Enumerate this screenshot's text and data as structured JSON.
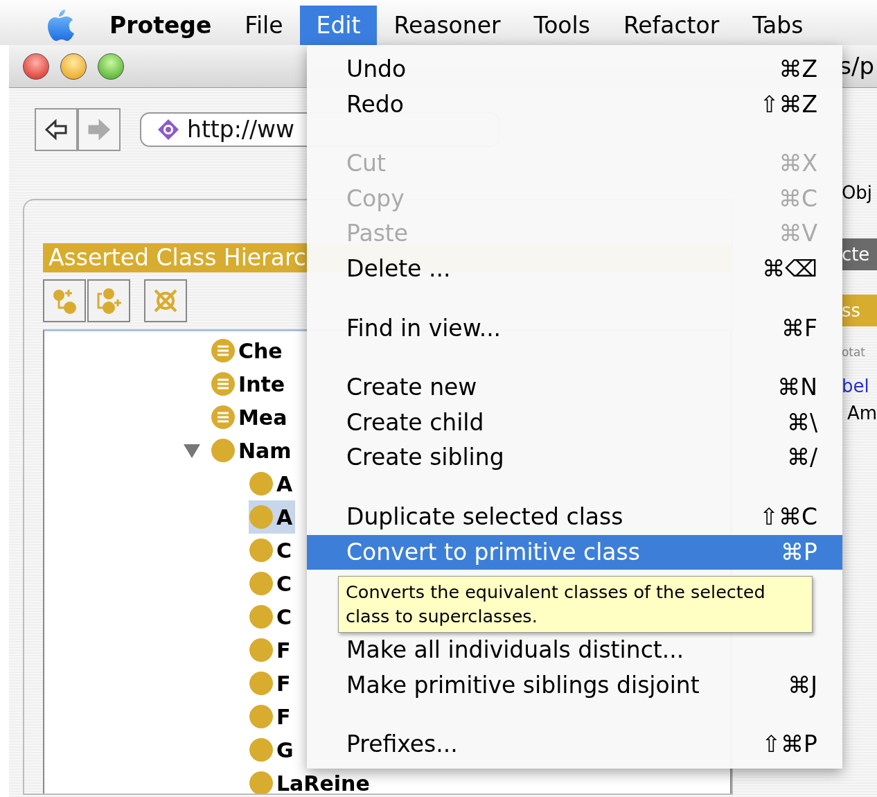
{
  "menu_bar": {
    "items": [
      {
        "label": "Protege",
        "kind": "app",
        "selected": false
      },
      {
        "label": "File",
        "kind": "menu",
        "selected": false
      },
      {
        "label": "Edit",
        "kind": "menu",
        "selected": true
      },
      {
        "label": "Reasoner",
        "kind": "menu",
        "selected": false
      },
      {
        "label": "Tools",
        "kind": "menu",
        "selected": false
      },
      {
        "label": "Refactor",
        "kind": "menu",
        "selected": false
      },
      {
        "label": "Tabs",
        "kind": "menu",
        "selected": false
      }
    ]
  },
  "window": {
    "title": "s/p"
  },
  "toolbar": {
    "nav_buttons": [
      {
        "kind": "back",
        "disabled": false
      },
      {
        "kind": "forward",
        "disabled": true
      }
    ],
    "address": {
      "value": "http://ww"
    }
  },
  "tabs": [
    {
      "label": "Obj"
    }
  ],
  "class_hierarchy": {
    "title": "Asserted Class Hierarc",
    "tools": [
      {
        "kind": "add-subclass"
      },
      {
        "kind": "add-sibling"
      },
      {
        "kind": "delete"
      }
    ],
    "tree": [
      {
        "label": "Che",
        "kind": "defined",
        "selected": false
      },
      {
        "label": "Inte",
        "kind": "defined",
        "selected": false
      },
      {
        "label": "Mea",
        "kind": "defined",
        "selected": false
      },
      {
        "label": "Nam",
        "kind": "primitive",
        "selected": false,
        "expanded": true,
        "children": [
          {
            "label": "A",
            "kind": "primitive",
            "selected": false
          },
          {
            "label": "A",
            "kind": "primitive",
            "selected": true
          },
          {
            "label": "C",
            "kind": "primitive",
            "selected": false
          },
          {
            "label": "C",
            "kind": "primitive",
            "selected": false
          },
          {
            "label": "C",
            "kind": "primitive",
            "selected": false
          },
          {
            "label": "F",
            "kind": "primitive",
            "selected": false
          },
          {
            "label": "F",
            "kind": "primitive",
            "selected": false
          },
          {
            "label": "F",
            "kind": "primitive",
            "selected": false
          },
          {
            "label": "G",
            "kind": "primitive",
            "selected": false
          },
          {
            "label": "LaReine",
            "kind": "primitive",
            "selected": false
          }
        ]
      }
    ]
  },
  "right_panel": {
    "selected_header": "cte",
    "class_header": "ss",
    "annotations_label": "otat",
    "annotation_property": "bel",
    "annotation_value": "Am"
  },
  "edit_menu": {
    "items": [
      {
        "kind": "item",
        "label": "Undo",
        "shortcut": "⌘Z",
        "disabled": false,
        "selected": false
      },
      {
        "kind": "item",
        "label": "Redo",
        "shortcut": "⇧⌘Z",
        "disabled": false,
        "selected": false
      },
      {
        "kind": "separator"
      },
      {
        "kind": "item",
        "label": "Cut",
        "shortcut": "⌘X",
        "disabled": true,
        "selected": false
      },
      {
        "kind": "item",
        "label": "Copy",
        "shortcut": "⌘C",
        "disabled": true,
        "selected": false
      },
      {
        "kind": "item",
        "label": "Paste",
        "shortcut": "⌘V",
        "disabled": true,
        "selected": false
      },
      {
        "kind": "item",
        "label": "Delete ...",
        "shortcut": "⌘⌫",
        "disabled": false,
        "selected": false
      },
      {
        "kind": "separator"
      },
      {
        "kind": "item",
        "label": "Find in view...",
        "shortcut": "⌘F",
        "disabled": false,
        "selected": false
      },
      {
        "kind": "separator"
      },
      {
        "kind": "item",
        "label": "Create new",
        "shortcut": "⌘N",
        "disabled": false,
        "selected": false
      },
      {
        "kind": "item",
        "label": "Create child",
        "shortcut": "⌘\\",
        "disabled": false,
        "selected": false
      },
      {
        "kind": "item",
        "label": "Create sibling",
        "shortcut": "⌘/",
        "disabled": false,
        "selected": false
      },
      {
        "kind": "separator"
      },
      {
        "kind": "item",
        "label": "Duplicate selected class",
        "shortcut": "⇧⌘C",
        "disabled": false,
        "selected": false
      },
      {
        "kind": "item",
        "label": "Convert to primitive class",
        "shortcut": "⌘P",
        "disabled": false,
        "selected": true
      },
      {
        "kind": "tooltip",
        "text": "Converts the equivalent classes of the selected class to superclasses."
      },
      {
        "kind": "item",
        "label": "Make all individuals distinct...",
        "disabled": false,
        "selected": false
      },
      {
        "kind": "item",
        "label": "Make primitive siblings disjoint",
        "shortcut": "⌘J",
        "disabled": false,
        "selected": false
      },
      {
        "kind": "separator"
      },
      {
        "kind": "item",
        "label": "Prefixes...",
        "shortcut": "⇧⌘P",
        "disabled": false,
        "selected": false
      }
    ]
  }
}
